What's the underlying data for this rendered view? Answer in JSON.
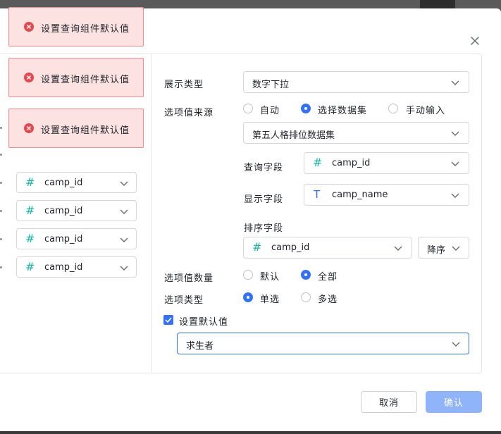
{
  "toasts": [
    {
      "message": "设置查询组件默认值"
    },
    {
      "message": "设置查询组件默认值"
    },
    {
      "message": "设置查询组件默认值"
    }
  ],
  "left_fields": [
    {
      "icon": "#",
      "value": "camp_id"
    },
    {
      "icon": "#",
      "value": "camp_id"
    },
    {
      "icon": "#",
      "value": "camp_id"
    },
    {
      "icon": "#",
      "value": "camp_id"
    }
  ],
  "form": {
    "display_type": {
      "label": "展示类型",
      "value": "数字下拉"
    },
    "option_source": {
      "label": "选项值来源",
      "options": [
        "自动",
        "选择数据集",
        "手动输入"
      ],
      "selected": "选择数据集",
      "dataset": "第五人格排位数据集"
    },
    "query_field": {
      "label": "查询字段",
      "icon": "#",
      "value": "camp_id"
    },
    "display_field": {
      "label": "显示字段",
      "icon": "T",
      "value": "camp_name"
    },
    "sort_field": {
      "label": "排序字段",
      "icon": "#",
      "value": "camp_id",
      "order": "降序"
    },
    "option_count": {
      "label": "选项值数量",
      "options": [
        "默认",
        "全部"
      ],
      "selected": "全部"
    },
    "option_type": {
      "label": "选项类型",
      "options": [
        "单选",
        "多选"
      ],
      "selected": "单选"
    },
    "default_value": {
      "label": "设置默认值",
      "checked": true,
      "value": "求生者"
    }
  },
  "footer": {
    "cancel_label": "取消",
    "confirm_label": "确认"
  },
  "colors": {
    "primary": "#3370ff",
    "error": "#e5484d",
    "teal": "#14b8a6"
  }
}
